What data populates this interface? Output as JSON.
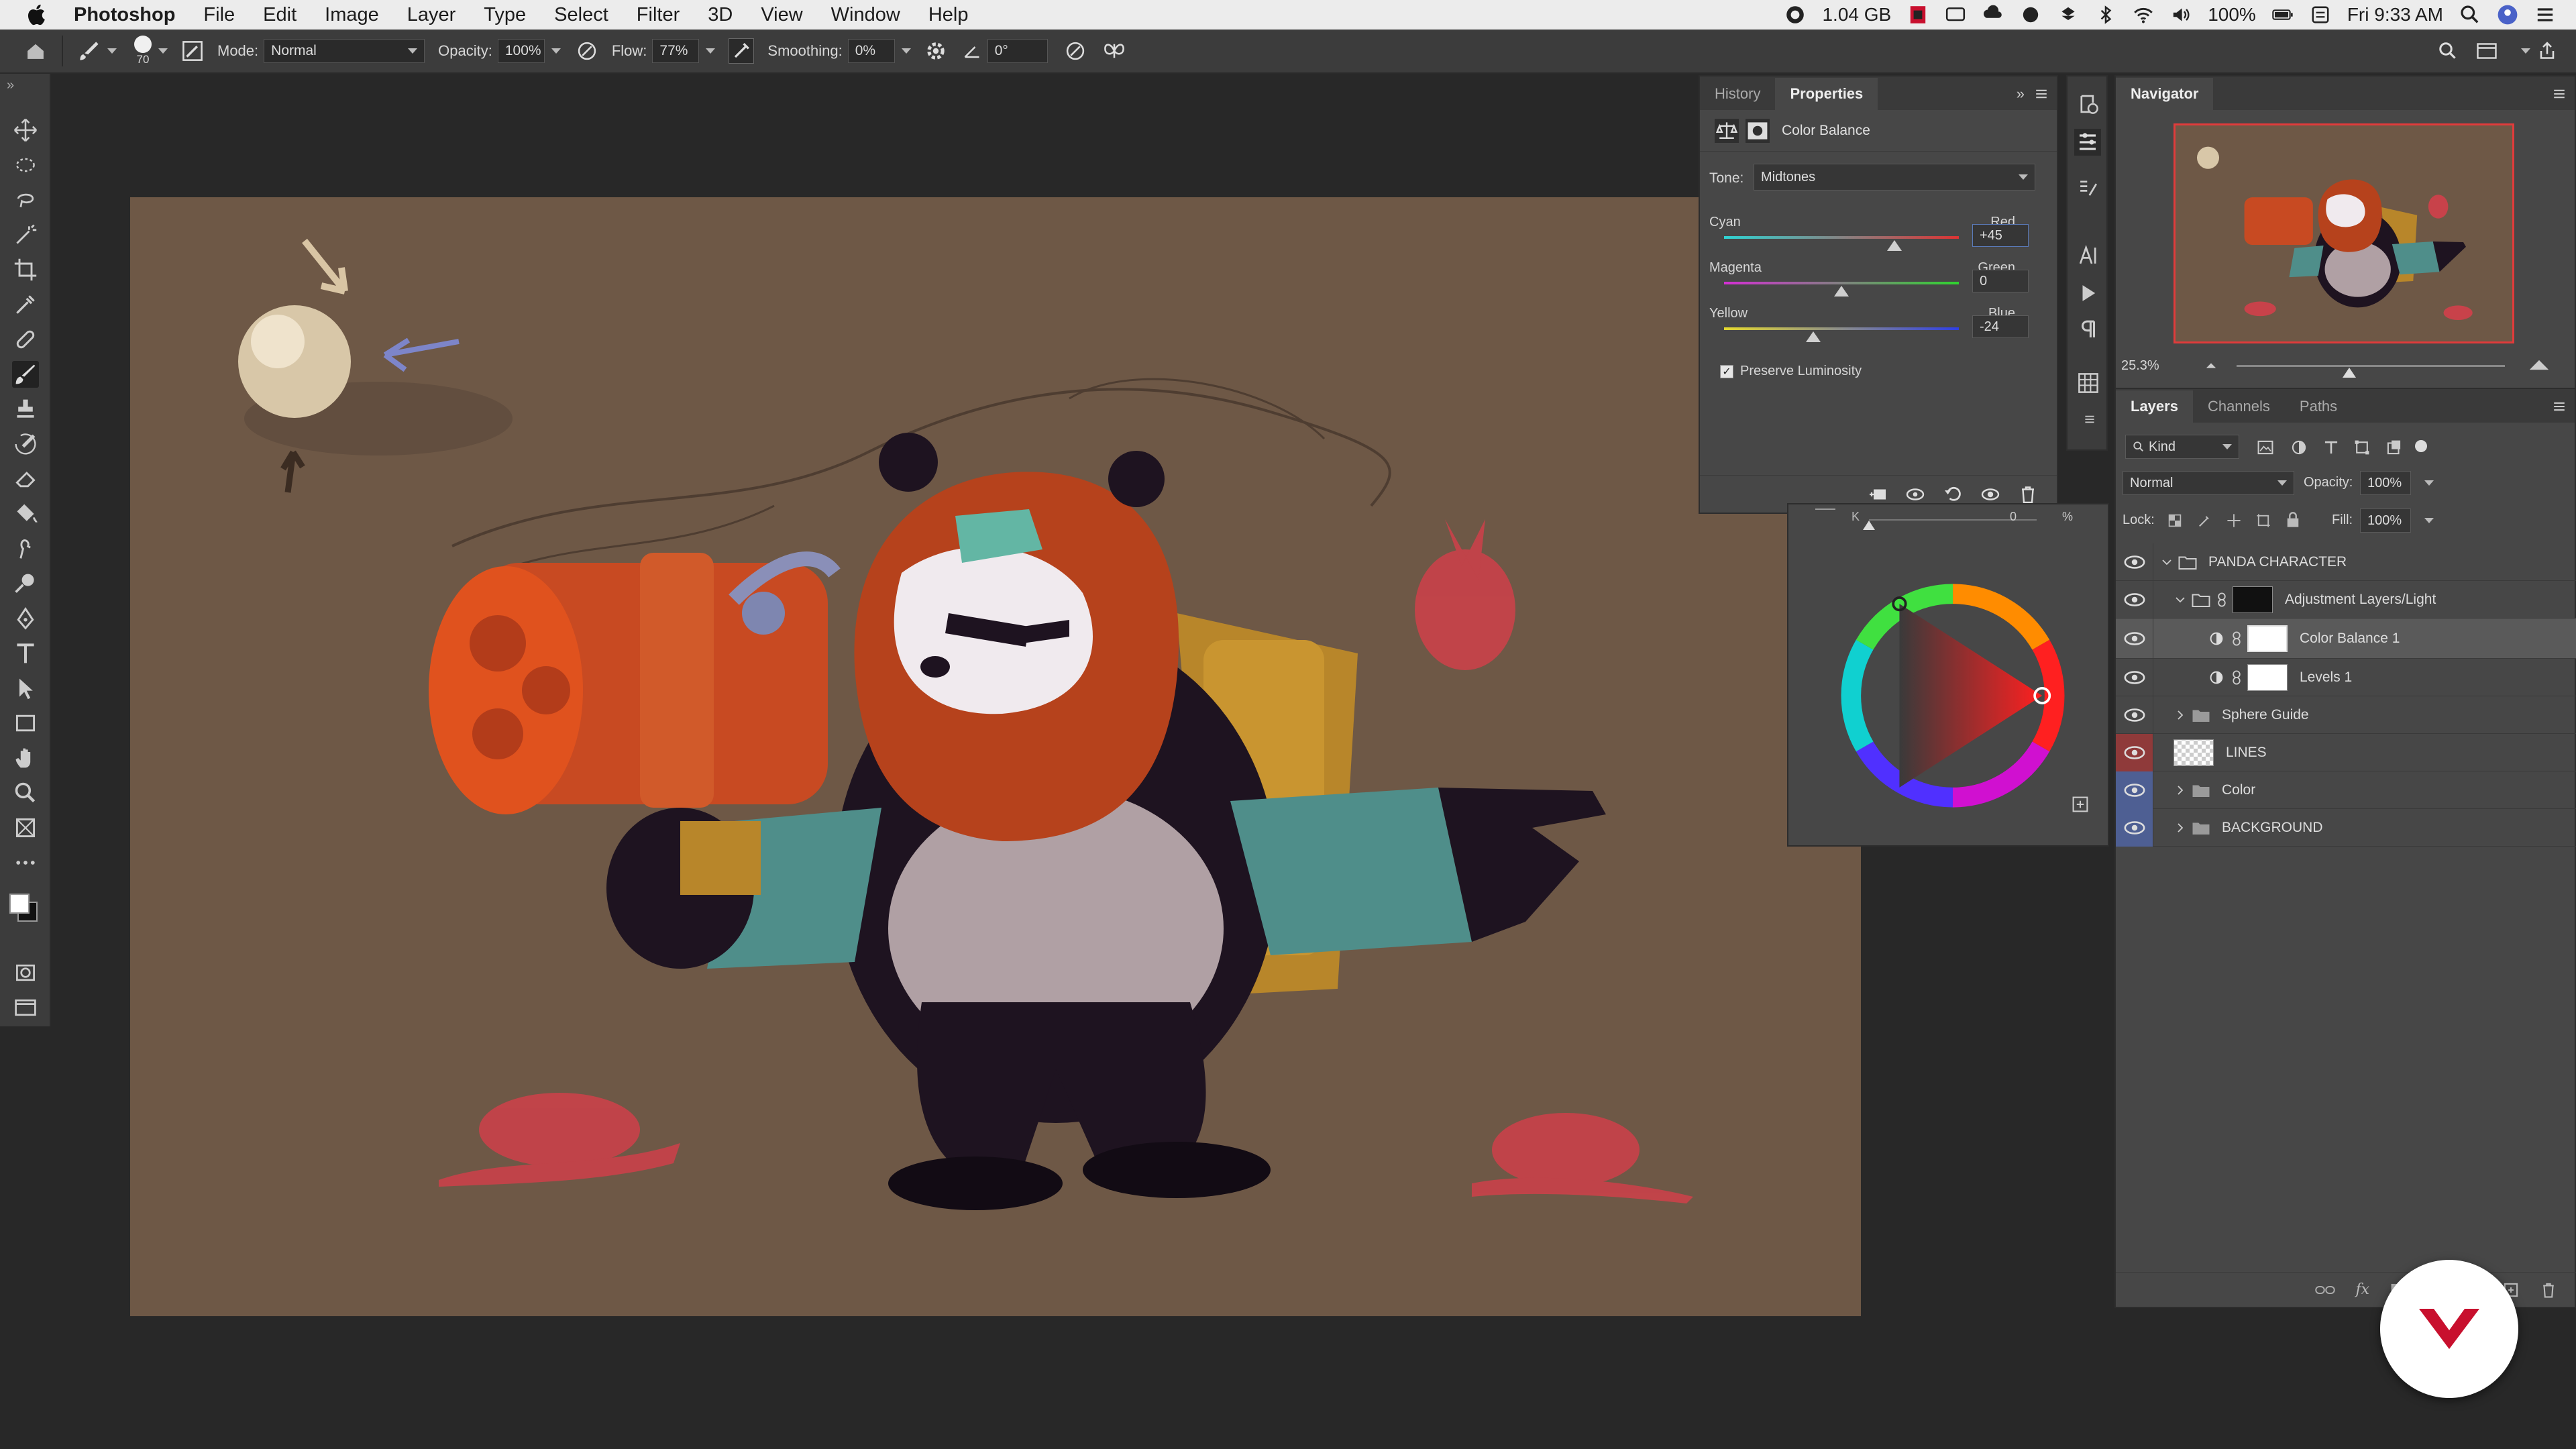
{
  "menubar": {
    "app_name": "Photoshop",
    "items": [
      "File",
      "Edit",
      "Image",
      "Layer",
      "Type",
      "Select",
      "Filter",
      "3D",
      "View",
      "Window",
      "Help"
    ],
    "memory": "1.04 GB",
    "battery": "100%",
    "clock": "Fri 9:33 AM"
  },
  "options_bar": {
    "brush_size": "70",
    "mode_label": "Mode:",
    "mode_value": "Normal",
    "opacity_label": "Opacity:",
    "opacity_value": "100%",
    "flow_label": "Flow:",
    "flow_value": "77%",
    "smoothing_label": "Smoothing:",
    "smoothing_value": "0%",
    "angle_value": "0°"
  },
  "properties_panel": {
    "tabs": [
      "History",
      "Properties"
    ],
    "active_tab": "Properties",
    "title": "Color Balance",
    "tone_label": "Tone:",
    "tone_value": "Midtones",
    "sliders": [
      {
        "left": "Cyan",
        "right": "Red",
        "value": "+45",
        "fraction": 0.725
      },
      {
        "left": "Magenta",
        "right": "Green",
        "value": "0",
        "fraction": 0.5
      },
      {
        "left": "Yellow",
        "right": "Blue",
        "value": "-24",
        "fraction": 0.38
      }
    ],
    "preserve_luminosity": "Preserve Luminosity",
    "preserve_checked": true
  },
  "color_panel": {
    "k_label": "K",
    "k_value": "0",
    "percent": "%"
  },
  "navigator": {
    "title": "Navigator",
    "zoom": "25.3%"
  },
  "layers_panel": {
    "tabs": [
      "Layers",
      "Channels",
      "Paths"
    ],
    "active_tab": "Layers",
    "filter_kind": "Kind",
    "blend_mode": "Normal",
    "opacity_label": "Opacity:",
    "opacity_value": "100%",
    "lock_label": "Lock:",
    "fill_label": "Fill:",
    "fill_value": "100%",
    "layers": [
      {
        "name": "PANDA CHARACTER",
        "type": "group",
        "indent": 0
      },
      {
        "name": "Adjustment Layers/Light",
        "type": "group",
        "indent": 1
      },
      {
        "name": "Color Balance 1",
        "type": "adjustment",
        "indent": 2,
        "selected": true
      },
      {
        "name": "Levels 1",
        "type": "adjustment",
        "indent": 2
      },
      {
        "name": "Sphere Guide",
        "type": "group",
        "indent": 1
      },
      {
        "name": "LINES",
        "type": "layer",
        "indent": 1
      },
      {
        "name": "Color",
        "type": "group",
        "indent": 1
      },
      {
        "name": "BACKGROUND",
        "type": "group",
        "indent": 1
      }
    ]
  },
  "colors": {
    "canvas_bg": "#6e5846",
    "accent_red": "#c8102e"
  }
}
